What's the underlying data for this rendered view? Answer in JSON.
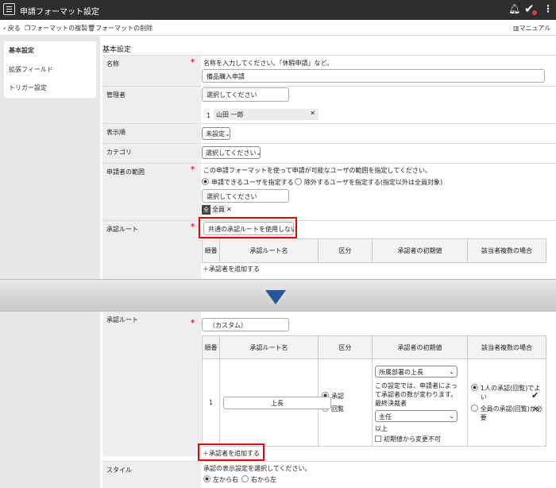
{
  "titlebar": {
    "title": "申請フォーマット設定"
  },
  "toolbar": {
    "back": "戻る",
    "copy": "フォーマットの複製",
    "delete": "フォーマットの削除",
    "manual": "マニュアル"
  },
  "sidebar": {
    "items": [
      {
        "label": "基本設定"
      },
      {
        "label": "拡張フィールド"
      },
      {
        "label": "トリガー設定"
      }
    ]
  },
  "section": {
    "title": "基本設定"
  },
  "fields": {
    "name": {
      "label": "名称",
      "hint": "名称を入力してください。「休暇申請」など。",
      "value": "備品購入申請"
    },
    "admin": {
      "label": "管理者",
      "placeholder": "選択してください",
      "entry_no": "1",
      "entry_name": "山田 一郎"
    },
    "order": {
      "label": "表示順",
      "value": "未設定"
    },
    "category": {
      "label": "カテゴリ",
      "value": "選択してください"
    },
    "applicant": {
      "label": "申請者の範囲",
      "hint": "この申請フォーマットを使って申請が可能なユーザの範囲を指定してください。",
      "opt1": "申請できるユーザを指定する",
      "opt2": "除外するユーザを指定する(指定以外は全員対象)",
      "placeholder": "選択してください",
      "badge_icon": "全",
      "badge_label": "全員"
    },
    "route": {
      "label": "承認ルート",
      "value_before": "共通の承認ルートを使用しない",
      "value_after": "（カスタム）",
      "add": "承認者を追加する"
    },
    "style": {
      "label": "スタイル",
      "hint": "承認の表示設定を選択してください。",
      "opt1": "左から右",
      "opt2": "右から左"
    }
  },
  "table": {
    "headers": [
      "順番",
      "承認ルート名",
      "区分",
      "承認者の初期値",
      "該当者複数の場合"
    ],
    "row": {
      "no": "1",
      "name": "上長",
      "kubun1": "承認",
      "kubun2": "回覧",
      "init_select": "所属部署の上長",
      "init_note": "この設定では、申請者によって承認者の数が変わります。最終決裁者",
      "final_select": "主任",
      "ika": "以上",
      "fixed": "初期値から変更不可",
      "multi1": "1人の承認(回覧)でよい",
      "multi2": "全員の承認(回覧)が必要"
    }
  },
  "icons": {
    "menu": "hamburger-icon",
    "bell": "bell-icon",
    "check": "check-icon",
    "more": "more-icon",
    "back": "chevron-left-icon",
    "copy": "copy-icon",
    "trash": "trash-icon",
    "book": "book-icon",
    "arrow": "down-arrow-icon",
    "plus": "plus-icon",
    "close": "close-icon"
  },
  "colors": {
    "titlebar": "#2d2d2d",
    "highlight": "#e00000",
    "arrow": "#24579a",
    "required": "#d32f2f"
  }
}
